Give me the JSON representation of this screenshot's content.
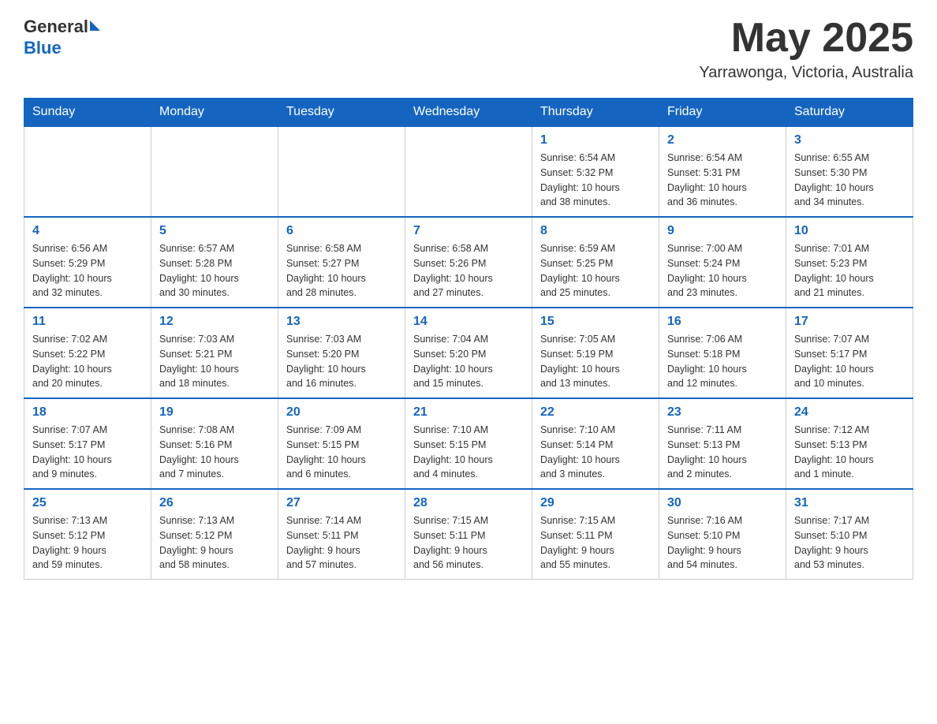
{
  "header": {
    "logo_text_general": "General",
    "logo_text_blue": "Blue",
    "month_title": "May 2025",
    "location": "Yarrawonga, Victoria, Australia"
  },
  "days_of_week": [
    "Sunday",
    "Monday",
    "Tuesday",
    "Wednesday",
    "Thursday",
    "Friday",
    "Saturday"
  ],
  "weeks": [
    {
      "days": [
        {
          "number": "",
          "info": ""
        },
        {
          "number": "",
          "info": ""
        },
        {
          "number": "",
          "info": ""
        },
        {
          "number": "",
          "info": ""
        },
        {
          "number": "1",
          "info": "Sunrise: 6:54 AM\nSunset: 5:32 PM\nDaylight: 10 hours\nand 38 minutes."
        },
        {
          "number": "2",
          "info": "Sunrise: 6:54 AM\nSunset: 5:31 PM\nDaylight: 10 hours\nand 36 minutes."
        },
        {
          "number": "3",
          "info": "Sunrise: 6:55 AM\nSunset: 5:30 PM\nDaylight: 10 hours\nand 34 minutes."
        }
      ]
    },
    {
      "days": [
        {
          "number": "4",
          "info": "Sunrise: 6:56 AM\nSunset: 5:29 PM\nDaylight: 10 hours\nand 32 minutes."
        },
        {
          "number": "5",
          "info": "Sunrise: 6:57 AM\nSunset: 5:28 PM\nDaylight: 10 hours\nand 30 minutes."
        },
        {
          "number": "6",
          "info": "Sunrise: 6:58 AM\nSunset: 5:27 PM\nDaylight: 10 hours\nand 28 minutes."
        },
        {
          "number": "7",
          "info": "Sunrise: 6:58 AM\nSunset: 5:26 PM\nDaylight: 10 hours\nand 27 minutes."
        },
        {
          "number": "8",
          "info": "Sunrise: 6:59 AM\nSunset: 5:25 PM\nDaylight: 10 hours\nand 25 minutes."
        },
        {
          "number": "9",
          "info": "Sunrise: 7:00 AM\nSunset: 5:24 PM\nDaylight: 10 hours\nand 23 minutes."
        },
        {
          "number": "10",
          "info": "Sunrise: 7:01 AM\nSunset: 5:23 PM\nDaylight: 10 hours\nand 21 minutes."
        }
      ]
    },
    {
      "days": [
        {
          "number": "11",
          "info": "Sunrise: 7:02 AM\nSunset: 5:22 PM\nDaylight: 10 hours\nand 20 minutes."
        },
        {
          "number": "12",
          "info": "Sunrise: 7:03 AM\nSunset: 5:21 PM\nDaylight: 10 hours\nand 18 minutes."
        },
        {
          "number": "13",
          "info": "Sunrise: 7:03 AM\nSunset: 5:20 PM\nDaylight: 10 hours\nand 16 minutes."
        },
        {
          "number": "14",
          "info": "Sunrise: 7:04 AM\nSunset: 5:20 PM\nDaylight: 10 hours\nand 15 minutes."
        },
        {
          "number": "15",
          "info": "Sunrise: 7:05 AM\nSunset: 5:19 PM\nDaylight: 10 hours\nand 13 minutes."
        },
        {
          "number": "16",
          "info": "Sunrise: 7:06 AM\nSunset: 5:18 PM\nDaylight: 10 hours\nand 12 minutes."
        },
        {
          "number": "17",
          "info": "Sunrise: 7:07 AM\nSunset: 5:17 PM\nDaylight: 10 hours\nand 10 minutes."
        }
      ]
    },
    {
      "days": [
        {
          "number": "18",
          "info": "Sunrise: 7:07 AM\nSunset: 5:17 PM\nDaylight: 10 hours\nand 9 minutes."
        },
        {
          "number": "19",
          "info": "Sunrise: 7:08 AM\nSunset: 5:16 PM\nDaylight: 10 hours\nand 7 minutes."
        },
        {
          "number": "20",
          "info": "Sunrise: 7:09 AM\nSunset: 5:15 PM\nDaylight: 10 hours\nand 6 minutes."
        },
        {
          "number": "21",
          "info": "Sunrise: 7:10 AM\nSunset: 5:15 PM\nDaylight: 10 hours\nand 4 minutes."
        },
        {
          "number": "22",
          "info": "Sunrise: 7:10 AM\nSunset: 5:14 PM\nDaylight: 10 hours\nand 3 minutes."
        },
        {
          "number": "23",
          "info": "Sunrise: 7:11 AM\nSunset: 5:13 PM\nDaylight: 10 hours\nand 2 minutes."
        },
        {
          "number": "24",
          "info": "Sunrise: 7:12 AM\nSunset: 5:13 PM\nDaylight: 10 hours\nand 1 minute."
        }
      ]
    },
    {
      "days": [
        {
          "number": "25",
          "info": "Sunrise: 7:13 AM\nSunset: 5:12 PM\nDaylight: 9 hours\nand 59 minutes."
        },
        {
          "number": "26",
          "info": "Sunrise: 7:13 AM\nSunset: 5:12 PM\nDaylight: 9 hours\nand 58 minutes."
        },
        {
          "number": "27",
          "info": "Sunrise: 7:14 AM\nSunset: 5:11 PM\nDaylight: 9 hours\nand 57 minutes."
        },
        {
          "number": "28",
          "info": "Sunrise: 7:15 AM\nSunset: 5:11 PM\nDaylight: 9 hours\nand 56 minutes."
        },
        {
          "number": "29",
          "info": "Sunrise: 7:15 AM\nSunset: 5:11 PM\nDaylight: 9 hours\nand 55 minutes."
        },
        {
          "number": "30",
          "info": "Sunrise: 7:16 AM\nSunset: 5:10 PM\nDaylight: 9 hours\nand 54 minutes."
        },
        {
          "number": "31",
          "info": "Sunrise: 7:17 AM\nSunset: 5:10 PM\nDaylight: 9 hours\nand 53 minutes."
        }
      ]
    }
  ]
}
